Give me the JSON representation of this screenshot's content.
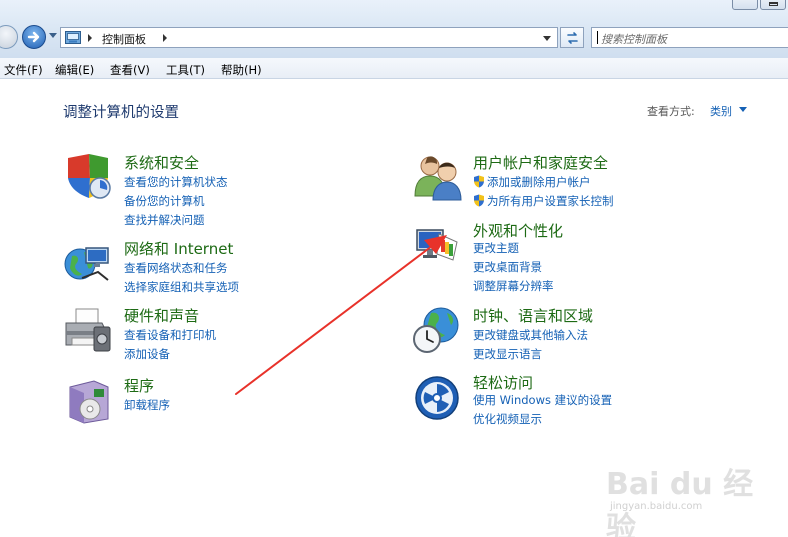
{
  "window": {
    "breadcrumb": "控制面板",
    "search_placeholder": "搜索控制面板"
  },
  "menu": [
    "文件(F)",
    "编辑(E)",
    "查看(V)",
    "工具(T)",
    "帮助(H)"
  ],
  "page": {
    "title": "调整计算机的设置",
    "view_by_label": "查看方式:",
    "view_by_value": "类别"
  },
  "categories": {
    "system": {
      "title": "系统和安全",
      "links": [
        "查看您的计算机状态",
        "备份您的计算机",
        "查找并解决问题"
      ]
    },
    "network": {
      "title": "网络和 Internet",
      "links": [
        "查看网络状态和任务",
        "选择家庭组和共享选项"
      ]
    },
    "hardware": {
      "title": "硬件和声音",
      "links": [
        "查看设备和打印机",
        "添加设备"
      ]
    },
    "programs": {
      "title": "程序",
      "links": [
        "卸载程序"
      ]
    },
    "users": {
      "title": "用户帐户和家庭安全",
      "links": [
        "添加或删除用户帐户",
        "为所有用户设置家长控制"
      ]
    },
    "appearance": {
      "title": "外观和个性化",
      "links": [
        "更改主题",
        "更改桌面背景",
        "调整屏幕分辨率"
      ]
    },
    "clock": {
      "title": "时钟、语言和区域",
      "links": [
        "更改键盘或其他输入法",
        "更改显示语言"
      ]
    },
    "ease": {
      "title": "轻松访问",
      "links": [
        "使用 Windows 建议的设置",
        "优化视频显示"
      ]
    }
  },
  "watermark": {
    "text": "Bai du 经验",
    "sub": "jingyan.baidu.com"
  },
  "colors": {
    "category_title": "#1d6a14",
    "link": "#1561b5",
    "annotation_arrow": "#e8322a"
  }
}
